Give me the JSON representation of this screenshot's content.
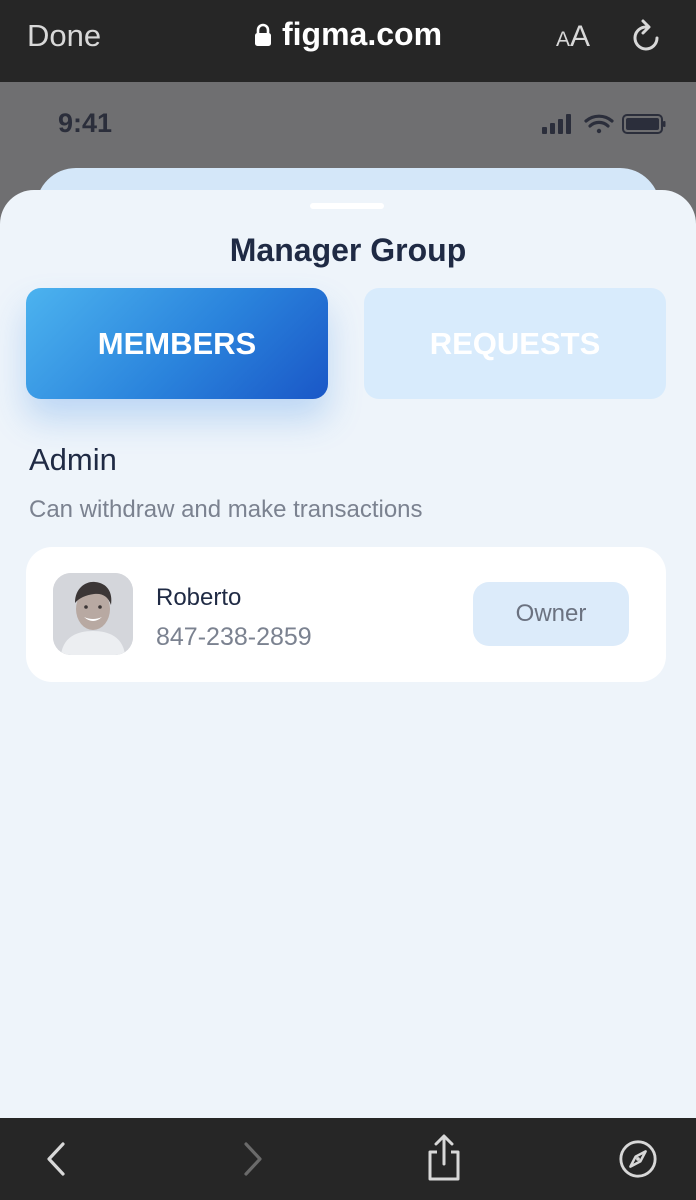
{
  "browser": {
    "done_label": "Done",
    "url": "figma.com",
    "text_size_small": "A",
    "text_size_large": "A"
  },
  "status_bar": {
    "time": "9:41"
  },
  "sheet": {
    "title": "Manager Group",
    "tabs": [
      {
        "label": "MEMBERS",
        "active": true
      },
      {
        "label": "REQUESTS",
        "active": false
      }
    ],
    "section": {
      "title": "Admin",
      "subtitle": "Can withdraw and make transactions"
    },
    "members": [
      {
        "name": "Roberto",
        "phone": "847-238-2859",
        "role": "Owner"
      }
    ]
  },
  "colors": {
    "accent_start": "#4cb3ef",
    "accent_end": "#1a57c7",
    "sheet_bg": "#eef4fa",
    "title_text": "#1f2a44"
  },
  "icons": [
    "lock-icon",
    "reload-icon",
    "signal-icon",
    "wifi-icon",
    "battery-icon",
    "back-arrow-icon",
    "forward-arrow-icon",
    "share-icon",
    "compass-icon"
  ]
}
